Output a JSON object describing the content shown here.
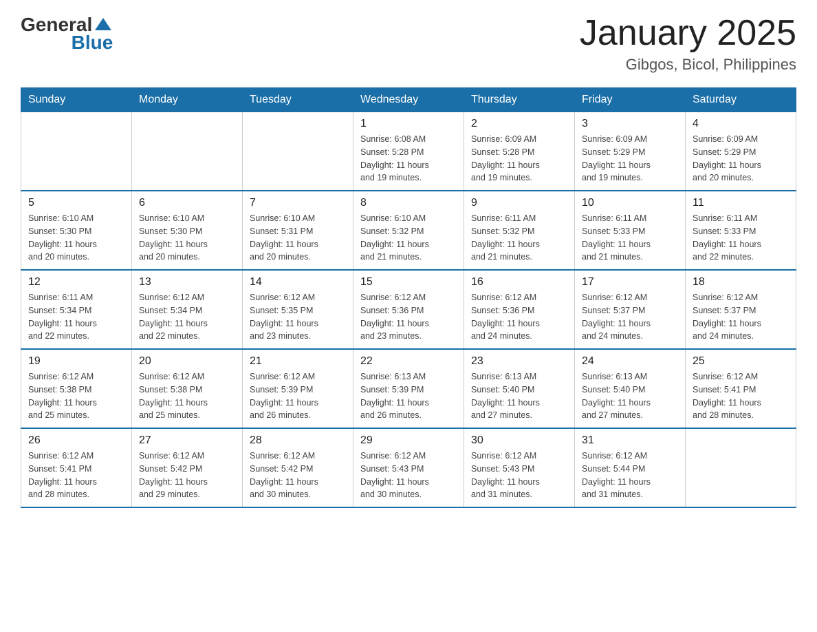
{
  "header": {
    "logo": {
      "text_general": "General",
      "text_blue": "Blue"
    },
    "month": "January 2025",
    "location": "Gibgos, Bicol, Philippines"
  },
  "days_of_week": [
    "Sunday",
    "Monday",
    "Tuesday",
    "Wednesday",
    "Thursday",
    "Friday",
    "Saturday"
  ],
  "weeks": [
    [
      {
        "day": "",
        "info": ""
      },
      {
        "day": "",
        "info": ""
      },
      {
        "day": "",
        "info": ""
      },
      {
        "day": "1",
        "info": "Sunrise: 6:08 AM\nSunset: 5:28 PM\nDaylight: 11 hours\nand 19 minutes."
      },
      {
        "day": "2",
        "info": "Sunrise: 6:09 AM\nSunset: 5:28 PM\nDaylight: 11 hours\nand 19 minutes."
      },
      {
        "day": "3",
        "info": "Sunrise: 6:09 AM\nSunset: 5:29 PM\nDaylight: 11 hours\nand 19 minutes."
      },
      {
        "day": "4",
        "info": "Sunrise: 6:09 AM\nSunset: 5:29 PM\nDaylight: 11 hours\nand 20 minutes."
      }
    ],
    [
      {
        "day": "5",
        "info": "Sunrise: 6:10 AM\nSunset: 5:30 PM\nDaylight: 11 hours\nand 20 minutes."
      },
      {
        "day": "6",
        "info": "Sunrise: 6:10 AM\nSunset: 5:30 PM\nDaylight: 11 hours\nand 20 minutes."
      },
      {
        "day": "7",
        "info": "Sunrise: 6:10 AM\nSunset: 5:31 PM\nDaylight: 11 hours\nand 20 minutes."
      },
      {
        "day": "8",
        "info": "Sunrise: 6:10 AM\nSunset: 5:32 PM\nDaylight: 11 hours\nand 21 minutes."
      },
      {
        "day": "9",
        "info": "Sunrise: 6:11 AM\nSunset: 5:32 PM\nDaylight: 11 hours\nand 21 minutes."
      },
      {
        "day": "10",
        "info": "Sunrise: 6:11 AM\nSunset: 5:33 PM\nDaylight: 11 hours\nand 21 minutes."
      },
      {
        "day": "11",
        "info": "Sunrise: 6:11 AM\nSunset: 5:33 PM\nDaylight: 11 hours\nand 22 minutes."
      }
    ],
    [
      {
        "day": "12",
        "info": "Sunrise: 6:11 AM\nSunset: 5:34 PM\nDaylight: 11 hours\nand 22 minutes."
      },
      {
        "day": "13",
        "info": "Sunrise: 6:12 AM\nSunset: 5:34 PM\nDaylight: 11 hours\nand 22 minutes."
      },
      {
        "day": "14",
        "info": "Sunrise: 6:12 AM\nSunset: 5:35 PM\nDaylight: 11 hours\nand 23 minutes."
      },
      {
        "day": "15",
        "info": "Sunrise: 6:12 AM\nSunset: 5:36 PM\nDaylight: 11 hours\nand 23 minutes."
      },
      {
        "day": "16",
        "info": "Sunrise: 6:12 AM\nSunset: 5:36 PM\nDaylight: 11 hours\nand 24 minutes."
      },
      {
        "day": "17",
        "info": "Sunrise: 6:12 AM\nSunset: 5:37 PM\nDaylight: 11 hours\nand 24 minutes."
      },
      {
        "day": "18",
        "info": "Sunrise: 6:12 AM\nSunset: 5:37 PM\nDaylight: 11 hours\nand 24 minutes."
      }
    ],
    [
      {
        "day": "19",
        "info": "Sunrise: 6:12 AM\nSunset: 5:38 PM\nDaylight: 11 hours\nand 25 minutes."
      },
      {
        "day": "20",
        "info": "Sunrise: 6:12 AM\nSunset: 5:38 PM\nDaylight: 11 hours\nand 25 minutes."
      },
      {
        "day": "21",
        "info": "Sunrise: 6:12 AM\nSunset: 5:39 PM\nDaylight: 11 hours\nand 26 minutes."
      },
      {
        "day": "22",
        "info": "Sunrise: 6:13 AM\nSunset: 5:39 PM\nDaylight: 11 hours\nand 26 minutes."
      },
      {
        "day": "23",
        "info": "Sunrise: 6:13 AM\nSunset: 5:40 PM\nDaylight: 11 hours\nand 27 minutes."
      },
      {
        "day": "24",
        "info": "Sunrise: 6:13 AM\nSunset: 5:40 PM\nDaylight: 11 hours\nand 27 minutes."
      },
      {
        "day": "25",
        "info": "Sunrise: 6:12 AM\nSunset: 5:41 PM\nDaylight: 11 hours\nand 28 minutes."
      }
    ],
    [
      {
        "day": "26",
        "info": "Sunrise: 6:12 AM\nSunset: 5:41 PM\nDaylight: 11 hours\nand 28 minutes."
      },
      {
        "day": "27",
        "info": "Sunrise: 6:12 AM\nSunset: 5:42 PM\nDaylight: 11 hours\nand 29 minutes."
      },
      {
        "day": "28",
        "info": "Sunrise: 6:12 AM\nSunset: 5:42 PM\nDaylight: 11 hours\nand 30 minutes."
      },
      {
        "day": "29",
        "info": "Sunrise: 6:12 AM\nSunset: 5:43 PM\nDaylight: 11 hours\nand 30 minutes."
      },
      {
        "day": "30",
        "info": "Sunrise: 6:12 AM\nSunset: 5:43 PM\nDaylight: 11 hours\nand 31 minutes."
      },
      {
        "day": "31",
        "info": "Sunrise: 6:12 AM\nSunset: 5:44 PM\nDaylight: 11 hours\nand 31 minutes."
      },
      {
        "day": "",
        "info": ""
      }
    ]
  ]
}
